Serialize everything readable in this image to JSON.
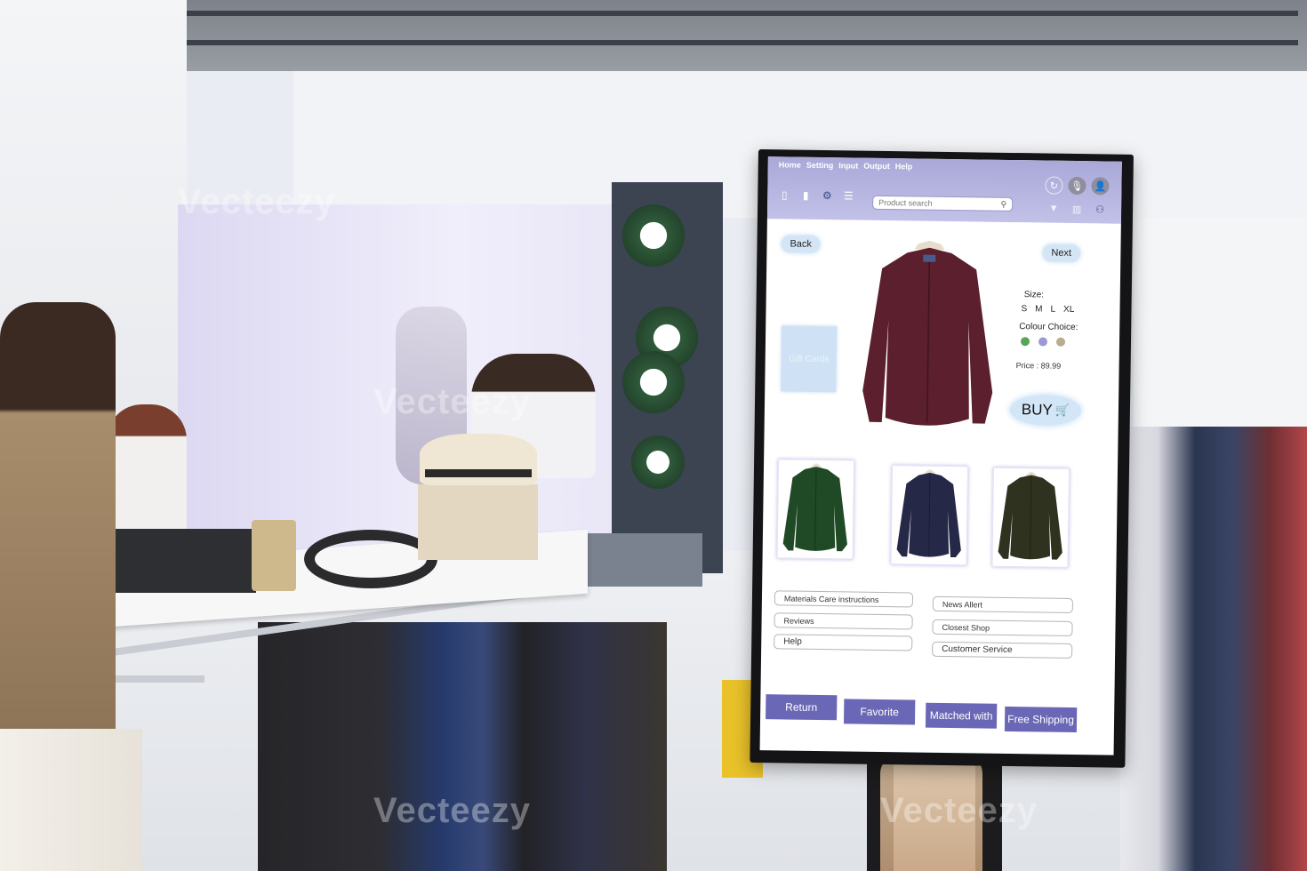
{
  "kiosk": {
    "menu": [
      "Home",
      "Setting",
      "Input",
      "Output",
      "Help"
    ],
    "toolbar_icons": [
      "panel-icon",
      "document-icon",
      "gear-icon",
      "hamburger-menu-icon"
    ],
    "search": {
      "placeholder": "Product search",
      "value": ""
    },
    "right_icons": [
      "refresh-icon",
      "microphone-icon",
      "user-profile-icon",
      "dropdown-arrow-icon",
      "clothing-icon",
      "account-icon"
    ],
    "nav": {
      "back": "Back",
      "next": "Next"
    },
    "gift_cards": "Gift Cards",
    "product": {
      "main_colour": "#5b1f2e",
      "size_label": "Size:",
      "sizes": [
        "S",
        "M",
        "L",
        "XL"
      ],
      "colour_label": "Colour Choice:",
      "colours": [
        "#58a55a",
        "#9b9ad4",
        "#b9ab8c"
      ],
      "price_label": "Price :",
      "price": "89.99",
      "buy": "BUY",
      "buy_icon": "shopping-cart-icon"
    },
    "variants": [
      {
        "name": "green",
        "colour": "#1f4a25"
      },
      {
        "name": "navy",
        "colour": "#262848"
      },
      {
        "name": "olive",
        "colour": "#2f321f"
      }
    ],
    "links_left": [
      "Materials  Care instructions",
      "Reviews",
      "Help"
    ],
    "links_right": [
      "News  Allert",
      "Closest Shop",
      "Customer Service"
    ],
    "actions": [
      "Return",
      "Favorite",
      "Matched with",
      "Free Shipping"
    ],
    "colors": {
      "header": "#b3b2df",
      "accent": "#6a68b6",
      "pill": "#d4e6f6"
    }
  },
  "watermark": "Vecteezy"
}
